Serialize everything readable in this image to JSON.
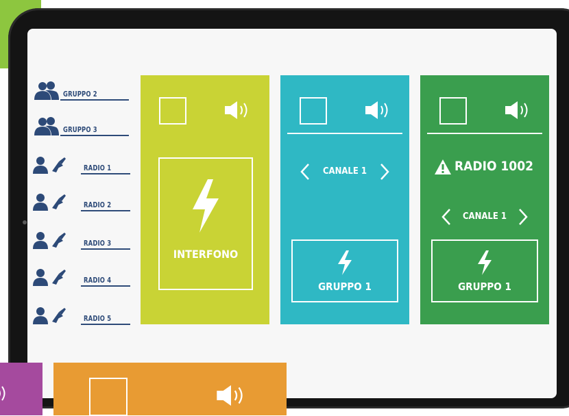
{
  "colors": {
    "yellow_panel": "#c9d335",
    "cyan_panel": "#2fb8c4",
    "green_panel": "#3a9e4e",
    "orange_panel": "#e89b33",
    "purple_panel": "#a54a9e",
    "accent_green": "#8dc63f",
    "label_blue": "#2d4a78"
  },
  "sidebar": {
    "items": [
      {
        "label": "GRUPPO 2",
        "icon": "group-icon"
      },
      {
        "label": "GRUPPO 3",
        "icon": "group-icon"
      },
      {
        "label": "RADIO 1",
        "icon": "user-radio-icon"
      },
      {
        "label": "RADIO 2",
        "icon": "user-radio-icon"
      },
      {
        "label": "RADIO 3",
        "icon": "user-radio-icon"
      },
      {
        "label": "RADIO 4",
        "icon": "user-radio-icon"
      },
      {
        "label": "RADIO 5",
        "icon": "user-radio-icon"
      }
    ]
  },
  "panels": {
    "intercom": {
      "label": "INTERFONO"
    },
    "channel": {
      "channel_label": "CANALE 1",
      "group_label": "GRUPPO 1"
    },
    "radio": {
      "title": "RADIO 1002",
      "channel_label": "CANALE 1",
      "group_label": "GRUPPO 1"
    }
  }
}
